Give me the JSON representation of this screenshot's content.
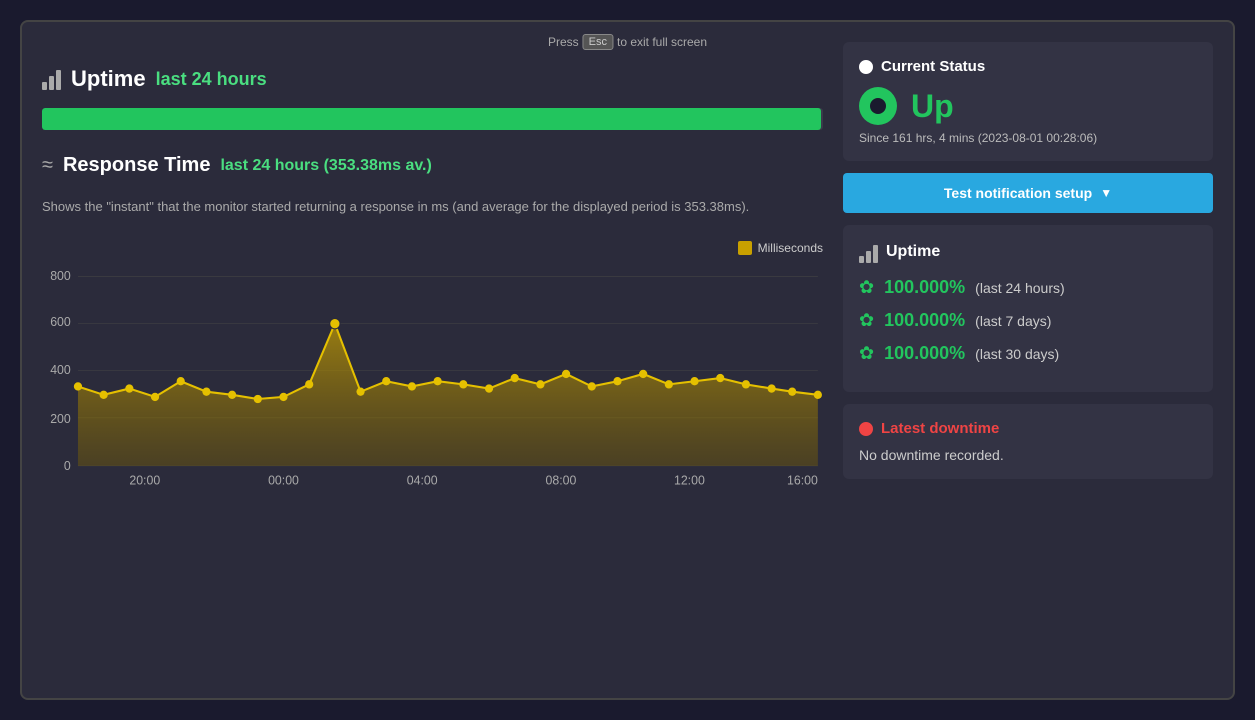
{
  "fullscreen_hint": {
    "press": "Press",
    "esc": "Esc",
    "hint": "to exit full screen"
  },
  "uptime_section": {
    "title": "Uptime",
    "subtitle": "last 24 hours",
    "bar_percent": 99.8
  },
  "response_section": {
    "title": "Response Time",
    "subtitle": "last 24 hours (353.38ms av.)",
    "description": "Shows the \"instant\" that the monitor started returning a response in ms (and average for the displayed period is 353.38ms).",
    "legend_label": "Milliseconds"
  },
  "chart": {
    "y_labels": [
      "800",
      "600",
      "400",
      "200",
      "0"
    ],
    "x_labels": [
      "20:00",
      "00:00",
      "04:00",
      "08:00",
      "12:00",
      "16:00"
    ],
    "color": "#c8a000"
  },
  "current_status": {
    "section_title": "Current Status",
    "status_label": "Up",
    "since_text": "Since 161 hrs, 4 mins (2023-08-01 00:28:06)"
  },
  "notification": {
    "button_label": "Test notification setup",
    "dropdown_arrow": "▼"
  },
  "uptime_card": {
    "title": "Uptime",
    "stats": [
      {
        "percent": "100.000%",
        "period": "(last 24 hours)"
      },
      {
        "percent": "100.000%",
        "period": "(last 7 days)"
      },
      {
        "percent": "100.000%",
        "period": "(last 30 days)"
      }
    ]
  },
  "latest_downtime": {
    "title": "Latest downtime",
    "message": "No downtime recorded."
  }
}
